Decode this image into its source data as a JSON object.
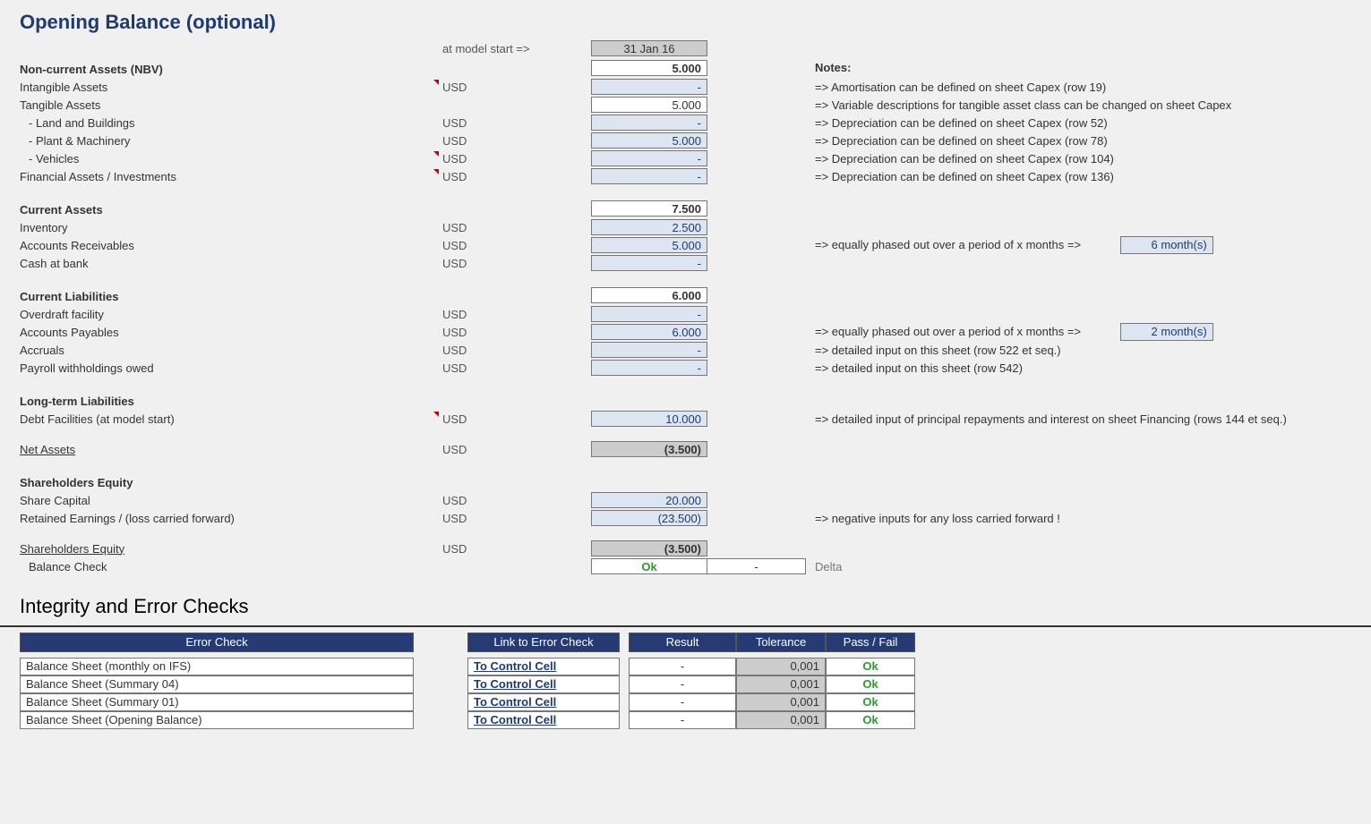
{
  "title": "Opening Balance (optional)",
  "model_start_label": "at model start =>",
  "date_header": "31 Jan 16",
  "notes_header": "Notes:",
  "sections": {
    "nca": {
      "head": "Non-current Assets (NBV)",
      "total": "5.000",
      "rows": [
        {
          "label": "Intangible Assets",
          "cur": "USD",
          "val": "-",
          "note": "=> Amortisation can be defined on sheet Capex (row 19)",
          "flag": true
        },
        {
          "label": "Tangible Assets",
          "cur": "",
          "val": "5.000",
          "note": "=> Variable descriptions for tangible asset class can be changed on sheet Capex",
          "input": false,
          "white": true
        },
        {
          "label": " - Land and Buildings",
          "cur": "USD",
          "val": "-",
          "note": "=> Depreciation can be defined on sheet Capex (row 52)",
          "sub": true
        },
        {
          "label": " - Plant & Machinery",
          "cur": "USD",
          "val": "5.000",
          "note": "=> Depreciation can be defined on sheet Capex (row 78)",
          "sub": true
        },
        {
          "label": " - Vehicles",
          "cur": "USD",
          "val": "-",
          "note": "=> Depreciation can be defined on sheet Capex (row 104)",
          "sub": true,
          "flag": true
        },
        {
          "label": "Financial Assets / Investments",
          "cur": "USD",
          "val": "-",
          "note": "=> Depreciation can be defined on sheet Capex (row 136)",
          "flag": true
        }
      ]
    },
    "ca": {
      "head": "Current Assets",
      "total": "7.500",
      "rows": [
        {
          "label": "Inventory",
          "cur": "USD",
          "val": "2.500"
        },
        {
          "label": "Accounts Receivables",
          "cur": "USD",
          "val": "5.000",
          "note": "=> equally phased out over a period of x months =>",
          "period": "6 month(s)"
        },
        {
          "label": "Cash at bank",
          "cur": "USD",
          "val": "-"
        }
      ]
    },
    "cl": {
      "head": "Current Liabilities",
      "total": "6.000",
      "rows": [
        {
          "label": "Overdraft facility",
          "cur": "USD",
          "val": "-"
        },
        {
          "label": "Accounts Payables",
          "cur": "USD",
          "val": "6.000",
          "note": "=> equally phased out over a period of x months =>",
          "period": "2 month(s)"
        },
        {
          "label": "Accruals",
          "cur": "USD",
          "val": "-",
          "note": "=> detailed input on this sheet (row 522 et seq.)"
        },
        {
          "label": "Payroll withholdings owed",
          "cur": "USD",
          "val": "-",
          "note": "=> detailed input on this sheet (row 542)"
        }
      ]
    },
    "ltl": {
      "head": "Long-term Liabilities",
      "rows": [
        {
          "label": "Debt Facilities (at model start)",
          "cur": "USD",
          "val": "10.000",
          "note": "=> detailed input of principal repayments and interest on sheet Financing (rows 144 et seq.)",
          "flag": true
        }
      ]
    },
    "net": {
      "label": "Net Assets",
      "cur": "USD",
      "val": "(3.500)"
    },
    "se": {
      "head": "Shareholders Equity",
      "rows": [
        {
          "label": "Share Capital",
          "cur": "USD",
          "val": "20.000"
        },
        {
          "label": "Retained Earnings / (loss carried forward)",
          "cur": "USD",
          "val": "(23.500)",
          "note": "=>  negative inputs for any loss carried forward !"
        }
      ],
      "total": {
        "label": "Shareholders Equity",
        "cur": "USD",
        "val": "(3.500)"
      }
    },
    "bc": {
      "label": "Balance Check",
      "ok": "Ok",
      "delta": "-",
      "delta_label": "Delta"
    }
  },
  "integrity": {
    "title": "Integrity and Error Checks",
    "headers": {
      "ec": "Error Check",
      "link": "Link to Error Check",
      "result": "Result",
      "tol": "Tolerance",
      "pf": "Pass / Fail"
    },
    "rows": [
      {
        "ec": "Balance Sheet (monthly on IFS)",
        "link": "To Control Cell",
        "res": "-",
        "tol": "0,001",
        "pf": "Ok"
      },
      {
        "ec": "Balance Sheet (Summary 04)",
        "link": "To Control Cell",
        "res": "-",
        "tol": "0,001",
        "pf": "Ok"
      },
      {
        "ec": "Balance Sheet (Summary 01)",
        "link": "To Control Cell",
        "res": "-",
        "tol": "0,001",
        "pf": "Ok"
      },
      {
        "ec": "Balance Sheet (Opening Balance)",
        "link": "To Control Cell",
        "res": "-",
        "tol": "0,001",
        "pf": "Ok"
      }
    ]
  }
}
